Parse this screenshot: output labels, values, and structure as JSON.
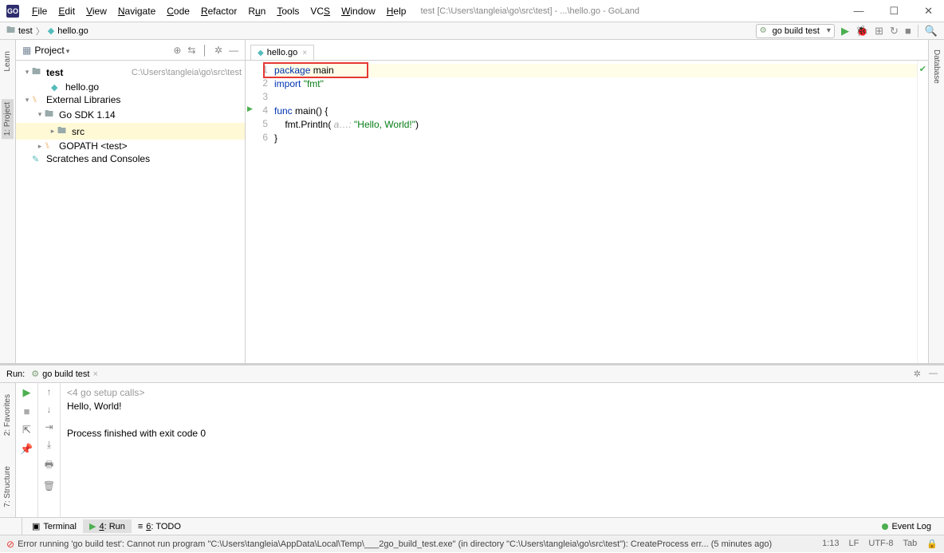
{
  "window": {
    "title": "test [C:\\Users\\tangleia\\go\\src\\test] - ...\\hello.go - GoLand"
  },
  "menu": {
    "file": "File",
    "edit": "Edit",
    "view": "View",
    "navigate": "Navigate",
    "code": "Code",
    "refactor": "Refactor",
    "run": "Run",
    "tools": "Tools",
    "vcs": "VCS",
    "window": "Window",
    "help": "Help"
  },
  "breadcrumb": {
    "project": "test",
    "file": "hello.go"
  },
  "build_config": "go build test",
  "left_rail": {
    "learn": "Learn",
    "project": "1: Project"
  },
  "right_rail": {
    "database": "Database"
  },
  "project_panel": {
    "title": "Project",
    "root": {
      "label": "test",
      "path": "C:\\Users\\tangleia\\go\\src\\test"
    },
    "root_file": "hello.go",
    "ext_lib": "External Libraries",
    "sdk": "Go SDK 1.14",
    "src": "src",
    "gopath": "GOPATH <test>",
    "scratches": "Scratches and Consoles"
  },
  "editor": {
    "tab": "hello.go",
    "lines": {
      "l1a": "package",
      "l1b": " main",
      "l2a": "import",
      "l2b": " ",
      "l2c": "\"fmt\"",
      "l4a": "func",
      "l4b": " main() {",
      "l5a": "    fmt.Println(",
      "l5h": " a…:",
      "l5b": " ",
      "l5c": "\"Hello, World!\"",
      "l5d": ")",
      "l6a": "}"
    }
  },
  "run_panel": {
    "label": "Run:",
    "config": "go build test",
    "console": {
      "setup": "<4 go setup calls>",
      "out": "Hello, World!",
      "exit": "Process finished with exit code 0"
    }
  },
  "left_rail2": {
    "favorites": "2: Favorites",
    "structure": "7: Structure"
  },
  "bottom_tabs": {
    "terminal": "Terminal",
    "run": "4: Run",
    "todo": "6: TODO",
    "event_log": "Event Log"
  },
  "statusbar": {
    "error": "Error running 'go build test': Cannot run program \"C:\\Users\\tangleia\\AppData\\Local\\Temp\\___2go_build_test.exe\" (in directory \"C:\\Users\\tangleia\\go\\src\\test\"): CreateProcess err... (5 minutes ago)",
    "pos": "1:13",
    "lf": "LF",
    "enc": "UTF-8",
    "tab": "Tab"
  }
}
